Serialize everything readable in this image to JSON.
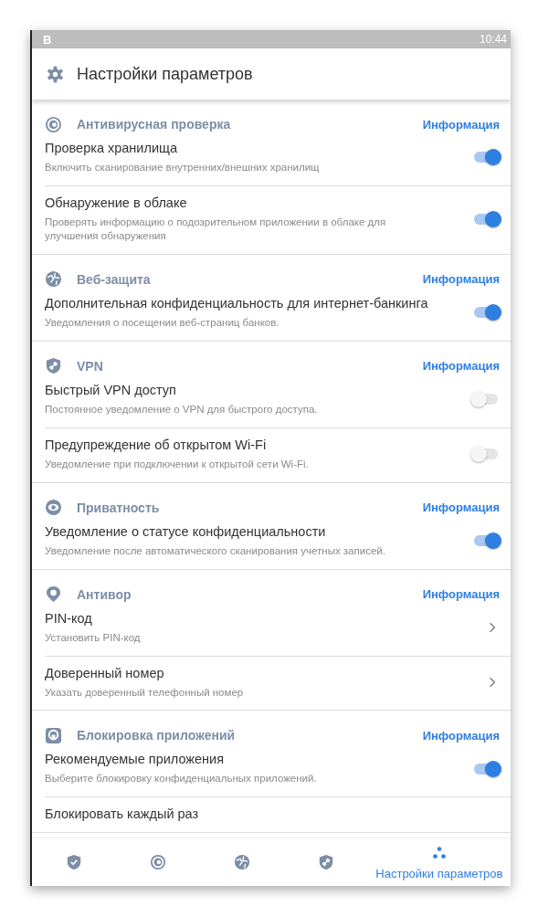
{
  "status_bar": {
    "app_letter": "B",
    "time": "10:44"
  },
  "header": {
    "title": "Настройки параметров"
  },
  "sections": [
    {
      "kind": "scan",
      "title": "Антивирусная проверка",
      "link": "Информация",
      "items": [
        {
          "kind": "toggle",
          "label": "Проверка хранилища",
          "description": "Включить сканирование внутренних/внешних хранилищ",
          "on": true
        },
        {
          "kind": "toggle",
          "label": "Обнаружение в облаке",
          "description": "Проверять информацию о подозрительном приложении в облаке для улучшения обнаружения",
          "on": true
        }
      ]
    },
    {
      "kind": "globe",
      "title": "Веб-защита",
      "link": "Информация",
      "items": [
        {
          "kind": "toggle",
          "label": "Дополнительная конфиденциальность для интернет-банкинга",
          "description": "Уведомления о посещении веб-страниц банков.",
          "on": true
        }
      ]
    },
    {
      "kind": "shield-link",
      "title": "VPN",
      "link": "Информация",
      "items": [
        {
          "kind": "toggle",
          "label": "Быстрый VPN доступ",
          "description": "Постоянное уведомление о VPN для быстрого доступа.",
          "on": false
        },
        {
          "kind": "toggle",
          "label": "Предупреждение об открытом Wi-Fi",
          "description": "Уведомление при подключении к открытой сети Wi-Fi.",
          "on": false
        }
      ]
    },
    {
      "kind": "eye",
      "title": "Приватность",
      "link": "Информация",
      "items": [
        {
          "kind": "toggle",
          "label": "Уведомление о статусе конфиденциальности",
          "description": "Уведомление после автоматического сканирования учетных записей.",
          "on": true
        }
      ]
    },
    {
      "kind": "pin",
      "title": "Антивор",
      "link": "Информация",
      "items": [
        {
          "kind": "link",
          "label": "PIN-код",
          "description": "Установить PIN-код"
        },
        {
          "kind": "link",
          "label": "Доверенный номер",
          "description": "Указать доверенный телефонный номер"
        }
      ]
    },
    {
      "kind": "lock",
      "title": "Блокировка приложений",
      "link": "Информация",
      "items": [
        {
          "kind": "toggle",
          "label": "Рекомендуемые приложения",
          "description": "Выберите блокировку конфиденциальных приложений.",
          "on": true
        },
        {
          "kind": "link",
          "label": "Блокировать каждый раз"
        }
      ]
    }
  ],
  "nav": [
    {
      "kind": "shield-check",
      "selected": false
    },
    {
      "kind": "scan",
      "selected": false
    },
    {
      "kind": "globe",
      "selected": false
    },
    {
      "kind": "shield-link",
      "selected": false
    },
    {
      "kind": "dots",
      "label": "Настройки параметров",
      "selected": true
    }
  ]
}
